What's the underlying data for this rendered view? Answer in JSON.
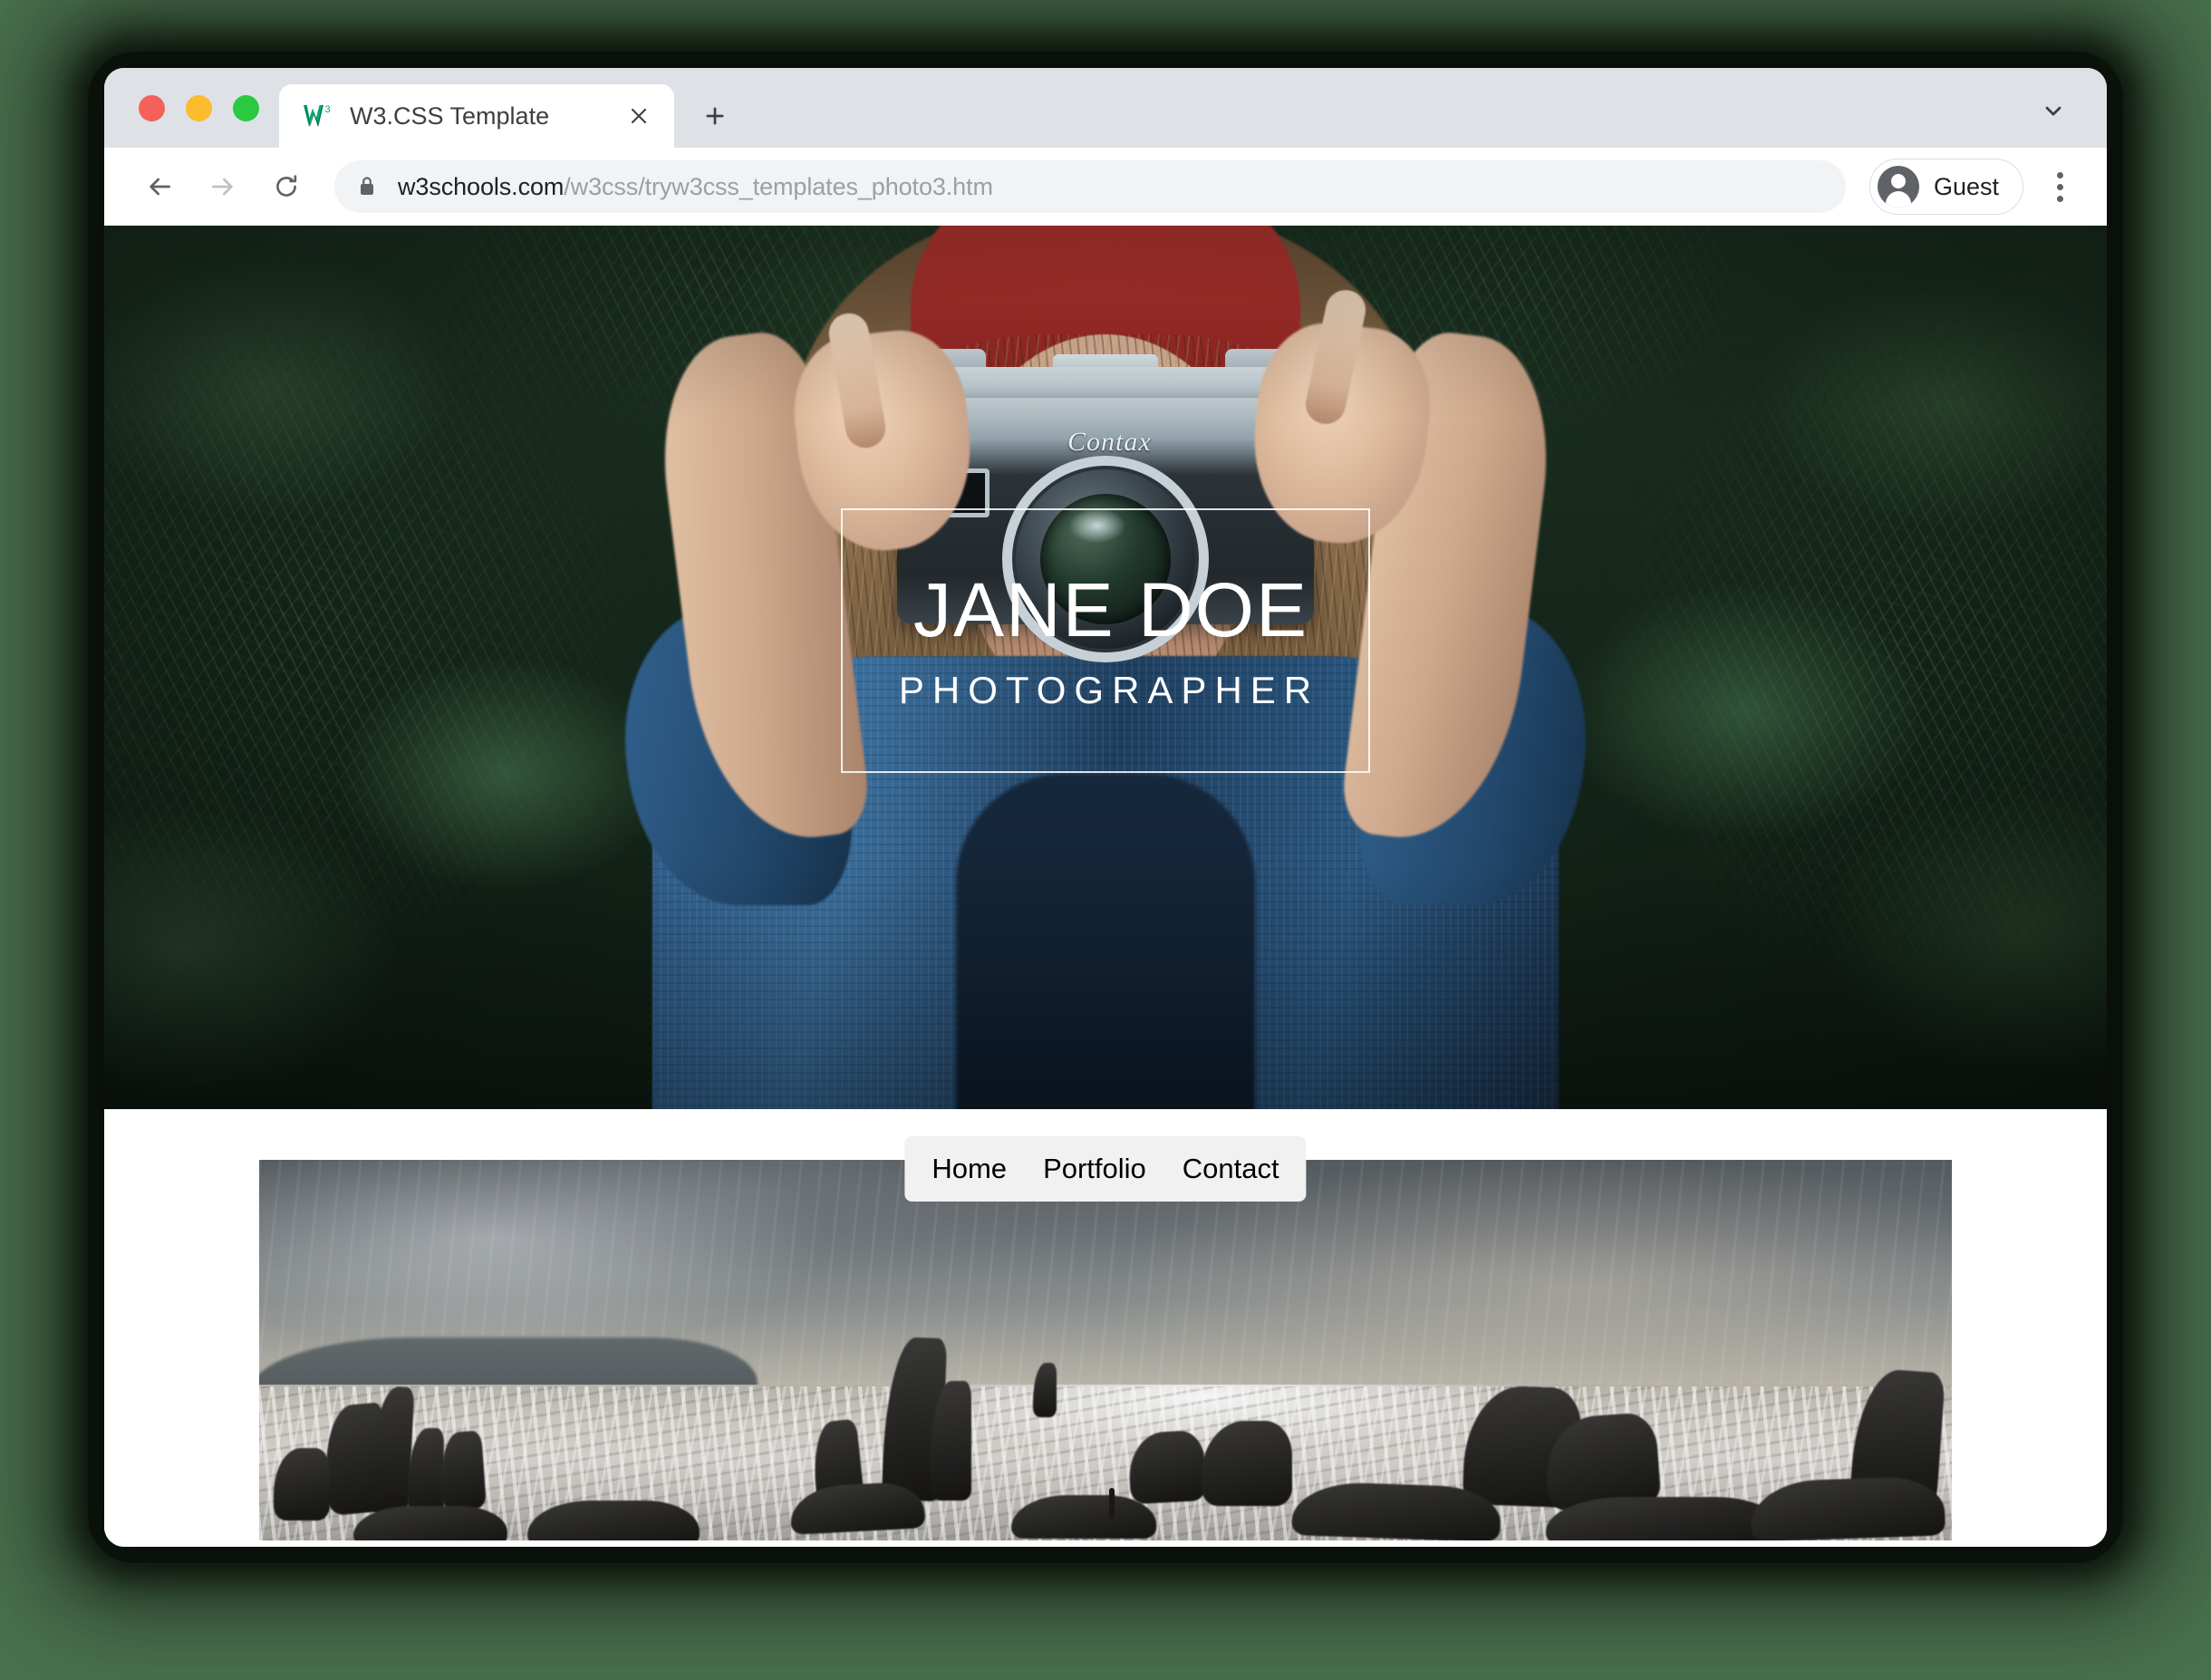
{
  "window": {
    "traffic_lights": [
      {
        "name": "close",
        "color": "#f5615a"
      },
      {
        "name": "minimize",
        "color": "#fbbc2e"
      },
      {
        "name": "maximize",
        "color": "#2bc940"
      }
    ]
  },
  "browser": {
    "tab": {
      "title": "W3.CSS Template",
      "favicon": "w3schools-logo-icon",
      "close_icon": "close-icon"
    },
    "new_tab_icon": "plus-icon",
    "tab_search_icon": "chevron-down-icon",
    "toolbar": {
      "back_icon": "arrow-left-icon",
      "forward_icon": "arrow-right-icon",
      "reload_icon": "reload-icon",
      "lock_icon": "lock-icon",
      "url_host": "w3schools.com",
      "url_path": "/w3css/tryw3css_templates_photo3.htm",
      "url_full": "w3schools.com/w3css/tryw3css_templates_photo3.htm",
      "profile_label": "Guest",
      "profile_icon": "account-avatar-icon",
      "menu_icon": "three-dot-menu-icon"
    }
  },
  "page": {
    "hero": {
      "name": "JANE DOE",
      "subtitle": "PHOTOGRAPHER",
      "image_alt": "woman-with-camera-photo",
      "camera_brand": "Contax"
    },
    "nav": {
      "items": [
        {
          "label": "Home"
        },
        {
          "label": "Portfolio"
        },
        {
          "label": "Contact"
        }
      ]
    },
    "gallery": {
      "items": [
        {
          "alt": "stormy-rocky-seascape-photo"
        }
      ]
    }
  },
  "colors": {
    "desktop_background": "#4a714d",
    "tab_strip": "#dee1e6",
    "omnibox": "#f1f3f4",
    "nav_bar": "#f1f1f1",
    "hero_overlay_border": "#ffffff"
  }
}
